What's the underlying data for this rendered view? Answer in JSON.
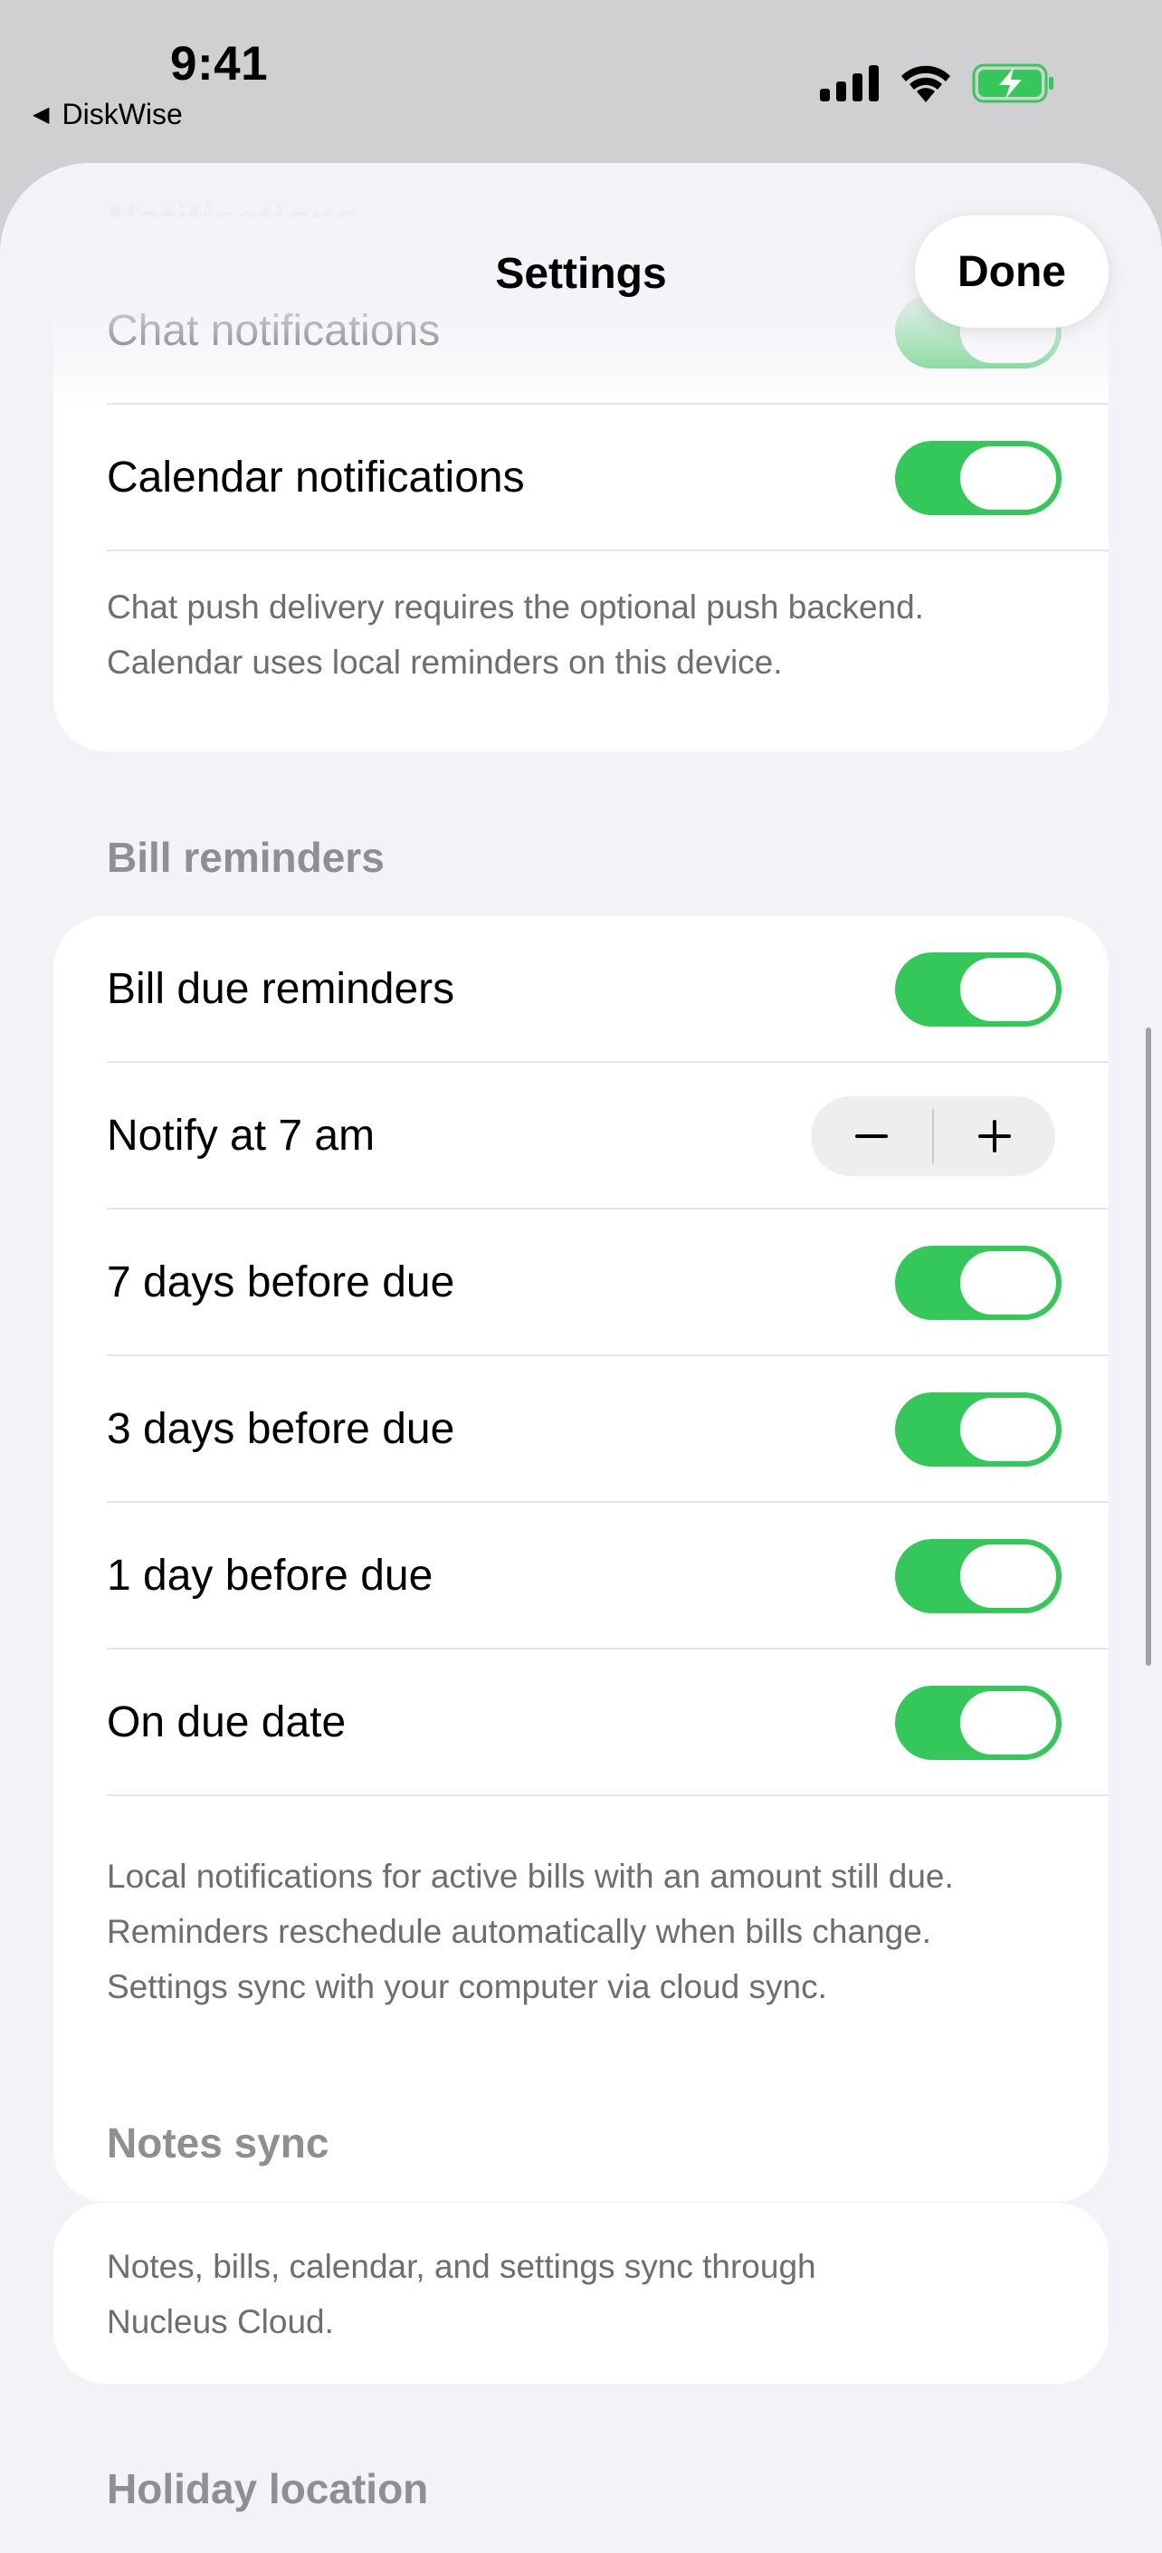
{
  "status_bar": {
    "time": "9:41",
    "back_app": "DiskWise",
    "icons": [
      "cellular-signal-icon",
      "wifi-icon",
      "battery-charging-icon"
    ]
  },
  "nav": {
    "title": "Settings",
    "done_label": "Done"
  },
  "sections": {
    "notifications": {
      "header": "Notifications",
      "rows": [
        {
          "label": "Chat notifications",
          "on": true
        },
        {
          "label": "Calendar notifications",
          "on": true
        }
      ],
      "footnote": [
        "Chat push delivery requires the optional push backend.",
        "Calendar uses local reminders on this device."
      ]
    },
    "bill_reminders": {
      "header": "Bill reminders",
      "rows": [
        {
          "label": "Bill due reminders",
          "on": true
        },
        {
          "label": "Notify at 7 am",
          "stepper": {
            "minus": "−",
            "plus": "+"
          }
        },
        {
          "label": "7 days before due",
          "on": true
        },
        {
          "label": "3 days before due",
          "on": true
        },
        {
          "label": "1 day before due",
          "on": true
        },
        {
          "label": "On due date",
          "on": true
        }
      ],
      "footnote": [
        "Local notifications for active bills with an amount still due.",
        "Reminders reschedule automatically when bills change.",
        "Settings sync with your computer via cloud sync."
      ]
    },
    "notes_sync": {
      "header": "Notes sync",
      "footnote": [
        "Notes, bills, calendar, and settings sync through",
        "Nucleus Cloud."
      ]
    },
    "holiday_location": {
      "header": "Holiday location"
    }
  },
  "colors": {
    "toggle_on": "#34c759",
    "battery_fill": "#34c759",
    "background": "#f2f2f7"
  }
}
